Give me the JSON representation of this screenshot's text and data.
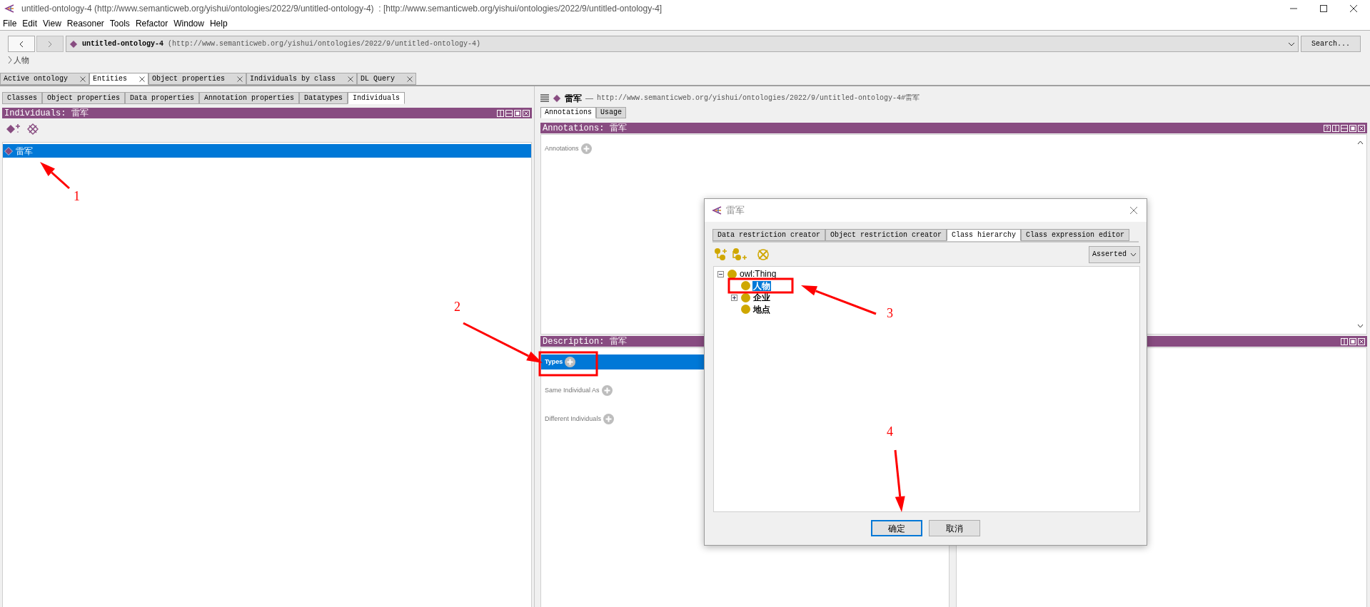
{
  "window": {
    "title": "untitled-ontology-4 (http://www.semanticweb.org/yishui/ontologies/2022/9/untitled-ontology-4)  : [http://www.semanticweb.org/yishui/ontologies/2022/9/untitled-ontology-4]"
  },
  "menu": [
    "File",
    "Edit",
    "View",
    "Reasoner",
    "Tools",
    "Refactor",
    "Window",
    "Help"
  ],
  "nav": {
    "ontology_name": "untitled-ontology-4",
    "ontology_iri": "(http://www.semanticweb.org/yishui/ontologies/2022/9/untitled-ontology-4)",
    "search_button": "Search..."
  },
  "breadcrumb": "人物",
  "tabs": [
    {
      "label": "Active ontology",
      "selected": false
    },
    {
      "label": "Entities",
      "selected": true
    },
    {
      "label": "Object properties",
      "selected": false
    },
    {
      "label": "Individuals by class",
      "selected": false
    },
    {
      "label": "DL Query",
      "selected": false
    }
  ],
  "entity_tabs": [
    {
      "label": "Classes",
      "selected": false
    },
    {
      "label": "Object properties",
      "selected": false
    },
    {
      "label": "Data properties",
      "selected": false
    },
    {
      "label": "Annotation properties",
      "selected": false
    },
    {
      "label": "Datatypes",
      "selected": false
    },
    {
      "label": "Individuals",
      "selected": true
    }
  ],
  "individuals_panel": {
    "title": "Individuals: 雷军",
    "items": [
      {
        "label": "雷军",
        "selected": true
      }
    ]
  },
  "entity_header": {
    "name": "雷军",
    "separator": "—",
    "iri": "http://www.semanticweb.org/yishui/ontologies/2022/9/untitled-ontology-4#雷军"
  },
  "detail_tabs": [
    {
      "label": "Annotations",
      "selected": true
    },
    {
      "label": "Usage",
      "selected": false
    }
  ],
  "annotations_panel": {
    "title": "Annotations: 雷军",
    "sections": [
      {
        "label": "Annotations"
      }
    ]
  },
  "description_panel": {
    "title": "Description: 雷军",
    "sections": [
      {
        "label": "Types",
        "selected": true
      },
      {
        "label": "Same Individual As",
        "selected": false
      },
      {
        "label": "Different Individuals",
        "selected": false
      }
    ]
  },
  "dialog": {
    "title": "雷军",
    "tabs": [
      {
        "label": "Data restriction creator",
        "selected": false
      },
      {
        "label": "Object restriction creator",
        "selected": false
      },
      {
        "label": "Class hierarchy",
        "selected": true
      },
      {
        "label": "Class expression editor",
        "selected": false
      }
    ],
    "mode": "Asserted",
    "tree": [
      {
        "label": "owl:Thing",
        "expanded": true,
        "selected": false,
        "children": [
          {
            "label": "人物",
            "selected": true
          },
          {
            "label": "企业",
            "selected": false,
            "expanded": false
          },
          {
            "label": "地点",
            "selected": false
          }
        ]
      }
    ],
    "buttons": [
      {
        "label": "确定",
        "default": true
      },
      {
        "label": "取消",
        "default": false
      }
    ]
  },
  "callouts": [
    {
      "number": "1"
    },
    {
      "number": "2"
    },
    {
      "number": "3"
    },
    {
      "number": "4"
    }
  ]
}
